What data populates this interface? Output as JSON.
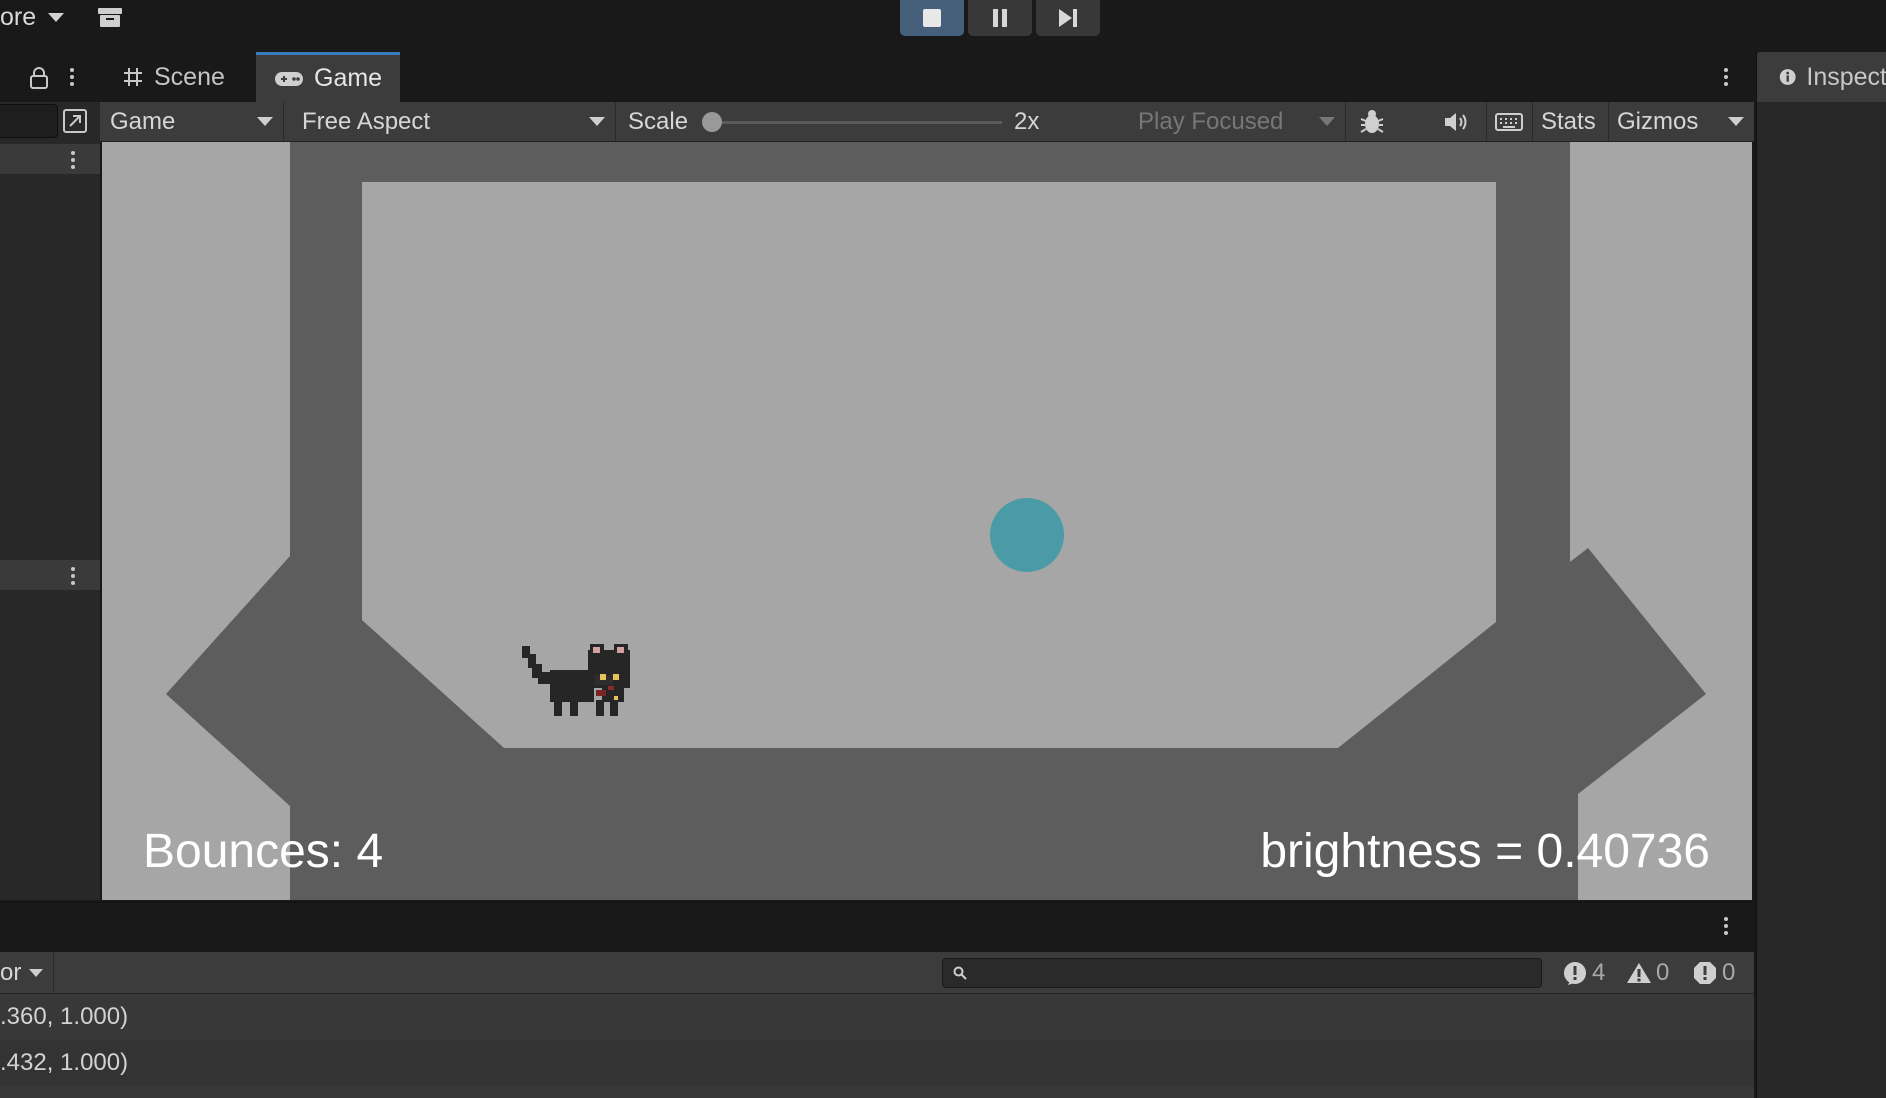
{
  "menu": {
    "label": "ore"
  },
  "play_controls": {
    "stop": "stop",
    "pause": "pause",
    "step": "step"
  },
  "tabs": [
    {
      "label": "Scene",
      "icon": "hash-grid-icon"
    },
    {
      "label": "Game",
      "icon": "gamepad-icon"
    }
  ],
  "game_toolbar": {
    "display": "Game",
    "aspect": "Free Aspect",
    "scale_label": "Scale",
    "scale_value": "2x",
    "scale_level": 0.0,
    "play_mode": "Play Focused",
    "stats": "Stats",
    "gizmos": "Gizmos"
  },
  "game_view": {
    "bounces_text": "Bounces: 4",
    "brightness_text": "brightness = 0.40736",
    "ball_color": "#4a9ba5",
    "wall_color": "#5d5d5d",
    "floor_color": "#a6a6a6"
  },
  "inspector": {
    "tab_label": "Inspect",
    "icon": "info-icon"
  },
  "console": {
    "dropdown_label": "or",
    "search_placeholder": "",
    "counts": {
      "errors": "4",
      "warnings": "0",
      "infos": "0"
    },
    "rows": [
      ".360, 1.000)",
      ".432, 1.000)"
    ]
  },
  "colors": {
    "accent": "#3a79bb",
    "play_active": "#46607c",
    "panel": "#3c3c3c"
  }
}
